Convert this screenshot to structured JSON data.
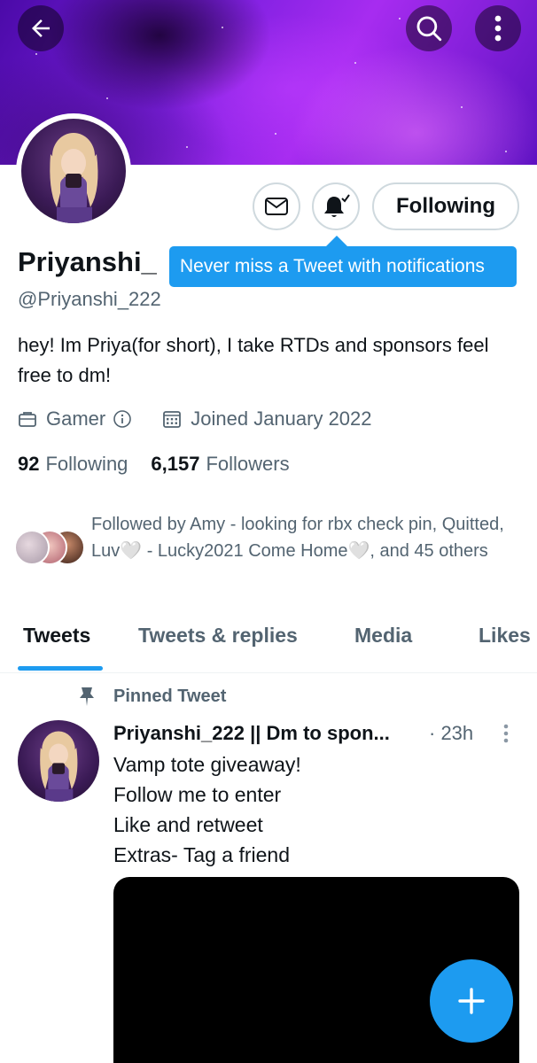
{
  "header": {
    "back_icon": "arrow-left-icon",
    "search_icon": "search-icon",
    "more_icon": "vertical-dots-icon"
  },
  "profile": {
    "name": "Priyanshi_",
    "handle": "@Priyanshi_222",
    "bio": "hey! Im Priya(for short), I take RTDs and sponsors feel free to dm!",
    "category": "Gamer",
    "joined": "Joined January 2022",
    "following_count": "92",
    "following_label": "Following",
    "followers_count": "6,157",
    "followers_label": "Followers"
  },
  "actions": {
    "message_icon": "envelope-icon",
    "notification_icon": "bell-check-icon",
    "following_button": "Following"
  },
  "tooltip": {
    "text": "Never miss a Tweet with notifications"
  },
  "followed_by": {
    "text": "Followed by Amy - looking for rbx check pin, Quitted, Luv🤍 - Lucky2021 Come Home🤍, and 45 others"
  },
  "tabs": [
    {
      "label": "Tweets",
      "active": true
    },
    {
      "label": "Tweets & replies",
      "active": false
    },
    {
      "label": "Media",
      "active": false
    },
    {
      "label": "Likes",
      "active": false
    }
  ],
  "pinned_tweet": {
    "pinned_label": "Pinned Tweet",
    "author": "Priyanshi_222 || Dm to spon...",
    "time": "· 23h",
    "lines": [
      "Vamp tote giveaway!",
      "Follow me to enter",
      "Like and retweet",
      "Extras- Tag a friend"
    ]
  },
  "fab": {
    "icon": "plus-icon"
  },
  "colors": {
    "accent": "#1d9bf0",
    "text_primary": "#0f1419",
    "text_secondary": "#536471",
    "border": "#cfd9de"
  }
}
